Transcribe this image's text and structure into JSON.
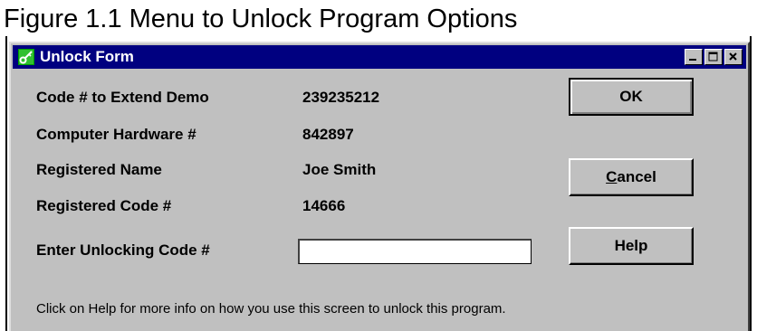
{
  "figure": {
    "caption": "Figure 1.1  Menu to Unlock Program Options"
  },
  "window": {
    "title": "Unlock Form",
    "controls": {
      "minimize": "minimize",
      "maximize": "maximize",
      "close": "close"
    }
  },
  "fields": [
    {
      "label": "Code # to Extend Demo",
      "value": "239235212"
    },
    {
      "label": "Computer Hardware #",
      "value": "842897"
    },
    {
      "label": "Registered Name",
      "value": "Joe Smith"
    },
    {
      "label": "Registered Code #",
      "value": "14666"
    }
  ],
  "unlock": {
    "label": "Enter Unlocking Code #",
    "value": "",
    "placeholder": ""
  },
  "buttons": {
    "ok": "OK",
    "cancel_mnemonic": "C",
    "cancel_rest": "ancel",
    "help": "Help"
  },
  "info": "Click on Help for more info on how you use this screen to unlock this program.",
  "icons": {
    "app": "key-icon",
    "minimize": "minimize-icon",
    "maximize": "maximize-icon",
    "close": "close-icon"
  },
  "colors": {
    "titlebar": "#000080",
    "window_bg": "#c0c0c0",
    "icon_green": "#00a000"
  }
}
